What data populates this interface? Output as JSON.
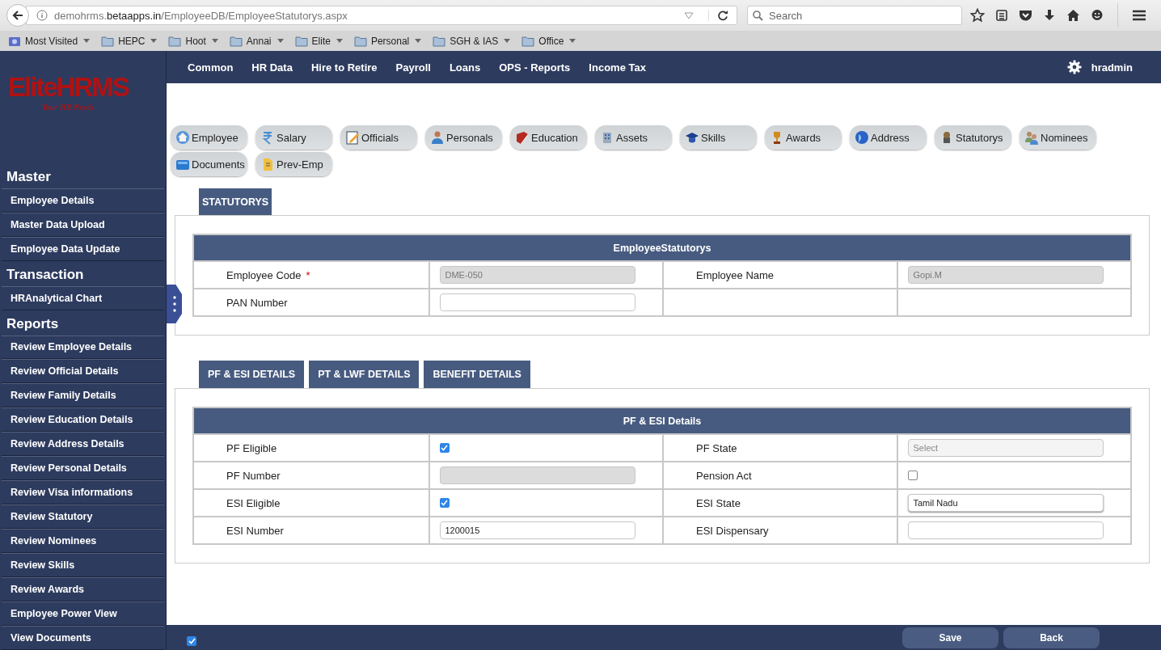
{
  "browser": {
    "url_host_prefix": "demohrms.",
    "url_host": "betaapps.in",
    "url_path": "/EmployeeDB/EmployeeStatutorys.aspx",
    "search": {
      "placeholder": "Search"
    },
    "bookmarks": [
      {
        "label": "Most Visited",
        "kind": "special"
      },
      {
        "label": "HEPC",
        "kind": "folder"
      },
      {
        "label": "Hoot",
        "kind": "folder"
      },
      {
        "label": "Annai",
        "kind": "folder"
      },
      {
        "label": "Elite",
        "kind": "folder"
      },
      {
        "label": "Personal",
        "kind": "folder"
      },
      {
        "label": "SGH & IAS",
        "kind": "folder"
      },
      {
        "label": "Office",
        "kind": "folder"
      }
    ]
  },
  "logo": {
    "name": "EliteHRMS",
    "tagline": "Your HR Needs"
  },
  "top_nav": {
    "items": [
      "Common",
      "HR Data",
      "Hire to Retire",
      "Payroll",
      "Loans",
      "OPS - Reports",
      "Income Tax"
    ],
    "user": "hradmin"
  },
  "sidebar": {
    "sections": [
      {
        "title": "Master",
        "items": [
          "Employee Details",
          "Master Data Upload",
          "Employee Data Update"
        ]
      },
      {
        "title": "Transaction",
        "items": [
          "HRAnalytical Chart"
        ]
      },
      {
        "title": "Reports",
        "items": [
          "Review Employee Details",
          "Review Official Details",
          "Review Family Details",
          "Review Education Details",
          "Review Address Details",
          "Review Personal Details",
          "Review Visa informations",
          "Review Statutory",
          "Review Nominees",
          "Review Skills",
          "Review Awards",
          "Employee Power View",
          "View Documents"
        ]
      }
    ]
  },
  "module_tabs": [
    {
      "label": "Employee",
      "selected": false
    },
    {
      "label": "Salary",
      "selected": false
    },
    {
      "label": "Officials",
      "selected": false
    },
    {
      "label": "Personals",
      "selected": false
    },
    {
      "label": "Education",
      "selected": false
    },
    {
      "label": "Assets",
      "selected": false
    },
    {
      "label": "Skills",
      "selected": false
    },
    {
      "label": "Awards",
      "selected": false
    },
    {
      "label": "Address",
      "selected": false
    },
    {
      "label": "Statutorys",
      "selected": false
    },
    {
      "label": "Nominees",
      "selected": false
    },
    {
      "label": "Documents",
      "selected": false
    },
    {
      "label": "Prev-Emp",
      "selected": false
    }
  ],
  "panels": [
    {
      "tabs": [
        "STATUTORYS"
      ],
      "table": {
        "title": "EmployeeStatutorys",
        "rows": [
          [
            {
              "kind": "label",
              "text": "Employee Code",
              "required_mark": "*"
            },
            {
              "kind": "input",
              "value": "DME-050",
              "disabled": true
            },
            {
              "kind": "label",
              "text": "Employee Name"
            },
            {
              "kind": "input",
              "value": "Gopi.M",
              "disabled": true
            }
          ],
          [
            {
              "kind": "label",
              "text": "PAN Number"
            },
            {
              "kind": "input",
              "disabled": false
            },
            {
              "kind": "empty"
            },
            {
              "kind": "empty"
            }
          ]
        ]
      }
    },
    {
      "tabs": [
        "PF & ESI DETAILS",
        "PT & LWF DETAILS",
        "BENEFIT DETAILS"
      ],
      "table": {
        "title": "PF & ESI Details",
        "rows": [
          [
            {
              "kind": "label",
              "text": "PF Eligible"
            },
            {
              "kind": "checkbox",
              "checked": true
            },
            {
              "kind": "label",
              "text": "PF State"
            },
            {
              "kind": "select",
              "value": "Select",
              "disabled": true
            }
          ],
          [
            {
              "kind": "label",
              "text": "PF Number"
            },
            {
              "kind": "input",
              "disabled": true
            },
            {
              "kind": "label",
              "text": "Pension Act"
            },
            {
              "kind": "checkbox",
              "checked": false
            }
          ],
          [
            {
              "kind": "label",
              "text": "ESI Eligible"
            },
            {
              "kind": "checkbox",
              "checked": true
            },
            {
              "kind": "label",
              "text": "ESI State"
            },
            {
              "kind": "select",
              "value": "Tamil Nadu",
              "disabled": false
            }
          ],
          [
            {
              "kind": "label",
              "text": "ESI Number"
            },
            {
              "kind": "input",
              "value": "1200015",
              "disabled": false
            },
            {
              "kind": "label",
              "text": "ESI Dispensary"
            },
            {
              "kind": "input",
              "disabled": false
            }
          ]
        ]
      }
    }
  ],
  "footer": {
    "checked": true,
    "buttons": [
      "Save",
      "Back"
    ]
  }
}
